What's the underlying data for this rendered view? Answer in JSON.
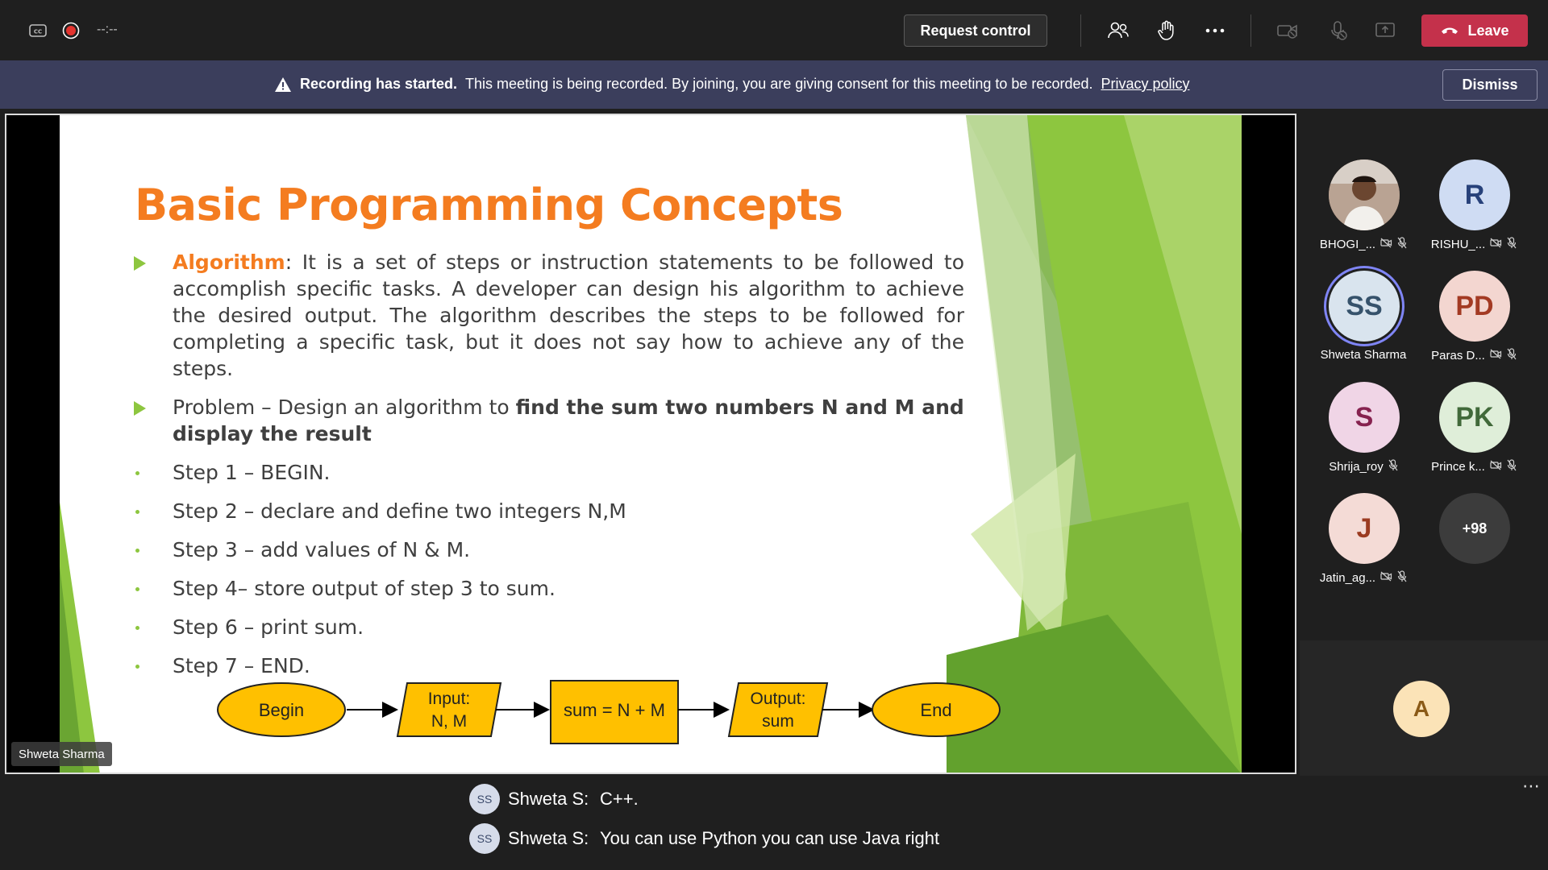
{
  "topbar": {
    "cc_icon": "closed-captions-icon",
    "record_icon": "recording-dot-icon",
    "timer": "--:--",
    "request_control": "Request control",
    "icons": [
      "people-icon",
      "raise-hand-icon",
      "more-icon",
      "camera-off-icon",
      "mic-off-icon",
      "share-tray-icon"
    ],
    "leave_label": "Leave",
    "leave_color": "#c4314b"
  },
  "banner": {
    "title": "Recording has started.",
    "message": "This meeting is being recorded. By joining, you are giving consent for this meeting to be recorded.",
    "link": "Privacy policy",
    "dismiss": "Dismiss",
    "bg_color": "#3b3e5c"
  },
  "slide": {
    "title": "Basic Programming Concepts",
    "algorithm_term": "Algorithm",
    "algorithm_text": ": It is a set of steps or instruction statements to be followed to accomplish specific tasks. A developer can design his algorithm to achieve the desired output. The algorithm describes the steps to be followed for completing a specific task, but it does not say how to achieve any of the steps.",
    "problem_prefix": "Problem – Design an algorithm to ",
    "problem_bold": "find the sum two numbers N and M and display the result",
    "steps": [
      "Step 1 – BEGIN.",
      "Step 2 – declare and define two integers N,M",
      "Step 3 – add values of N & M.",
      "Step 4– store output of step 3 to sum.",
      "Step 6 – print sum.",
      "Step 7 – END."
    ],
    "flow": {
      "begin": "Begin",
      "input_l1": "Input:",
      "input_l2": "N, M",
      "process": "sum = N + M",
      "output_l1": "Output:",
      "output_l2": "sum",
      "end": "End"
    },
    "title_color": "#f47c20",
    "accent_color": "#8dc63f",
    "shape_color": "#ffc000"
  },
  "presenter_tag": "Shweta Sharma",
  "participants": [
    {
      "initials": "",
      "name": "BHOGI_...",
      "photo": true,
      "status": [
        "camera-off-icon",
        "mic-off-icon"
      ]
    },
    {
      "initials": "R",
      "name": "RISHU_...",
      "bg": "#cfdcf3",
      "fg": "#27417a",
      "status": [
        "camera-off-icon",
        "mic-off-icon"
      ]
    },
    {
      "initials": "SS",
      "name": "Shweta Sharma",
      "bg": "#d9e4ee",
      "fg": "#36526b",
      "active": true,
      "status": []
    },
    {
      "initials": "PD",
      "name": "Paras D...",
      "bg": "#f3d6d0",
      "fg": "#a33a23",
      "status": [
        "camera-off-icon",
        "mic-off-icon"
      ]
    },
    {
      "initials": "S",
      "name": "Shrija_roy",
      "bg": "#f0d5e6",
      "fg": "#86224f",
      "status": [
        "mic-off-icon"
      ]
    },
    {
      "initials": "PK",
      "name": "Prince k...",
      "bg": "#dfeed9",
      "fg": "#41693a",
      "status": [
        "camera-off-icon",
        "mic-off-icon"
      ]
    },
    {
      "initials": "J",
      "name": "Jatin_ag...",
      "bg": "#f4dbd6",
      "fg": "#9b3b21",
      "status": [
        "camera-off-icon",
        "mic-off-icon"
      ]
    },
    {
      "initials": "+98",
      "name": "",
      "bg": "#3c3c3c",
      "fg": "#ffffff",
      "status": []
    }
  ],
  "audience_avatar": "A",
  "captions": [
    {
      "initials": "SS",
      "speaker": "Shweta S:",
      "text": "C++."
    },
    {
      "initials": "SS",
      "speaker": "Shweta S:",
      "text": "You can use Python you can use Java right"
    }
  ],
  "captions_more_icon": "more-icon"
}
